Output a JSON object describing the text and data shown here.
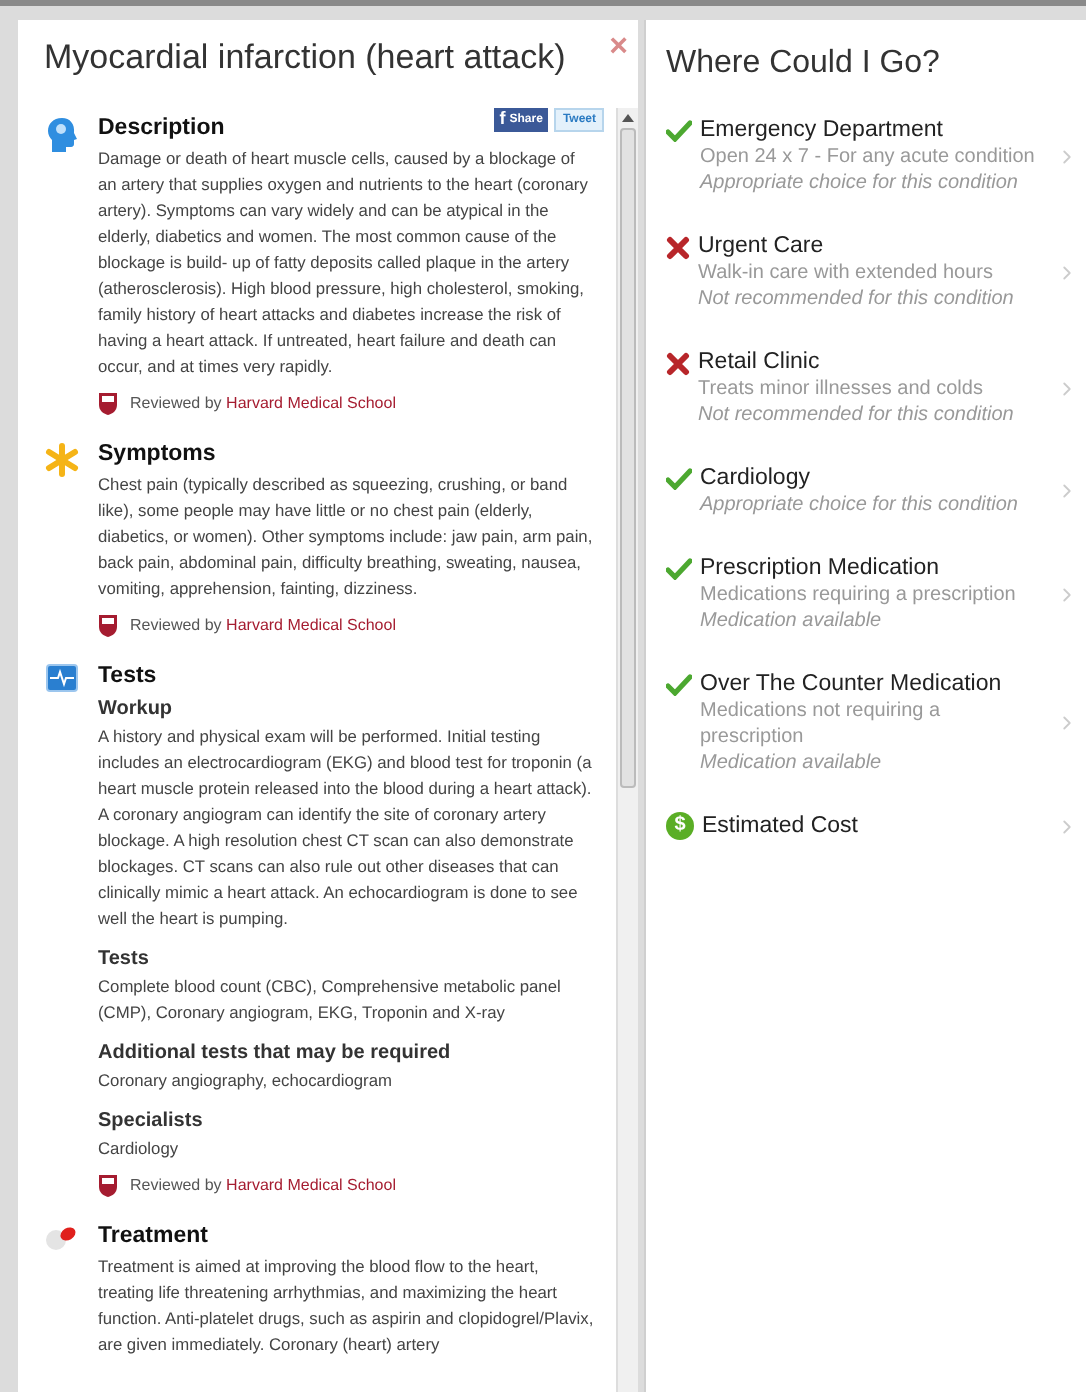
{
  "condition_panel": {
    "title": "Myocardial infarction (heart attack)",
    "close": "×",
    "share": {
      "icon": "f",
      "label": "Share"
    },
    "tweet": {
      "label": "Tweet"
    },
    "sections": [
      {
        "kind": "description",
        "title": "Description",
        "blocks": [
          {
            "text": "Damage or death of heart muscle cells, caused by a blockage of an artery that supplies oxygen and nutrients to the heart (coronary artery). Symptoms can vary widely and can be atypical in the elderly, diabetics and women. The most common cause of the blockage is build- up of fatty deposits called plaque in the artery (atherosclerosis). High blood pressure, high cholesterol, smoking, family history of heart attacks and diabetes increase the risk of having a heart attack. If untreated, heart failure and death can occur, and at times very rapidly."
          }
        ],
        "reviewed": {
          "prefix": "Reviewed by",
          "source": "Harvard Medical School"
        }
      },
      {
        "kind": "symptoms",
        "title": "Symptoms",
        "blocks": [
          {
            "text": "Chest pain (typically described as squeezing, crushing, or band like), some people may have little or no chest pain (elderly, diabetics, or women). Other symptoms include: jaw pain, arm pain, back pain, abdominal pain, difficulty breathing, sweating, nausea, vomiting, apprehension, fainting, dizziness."
          }
        ],
        "reviewed": {
          "prefix": "Reviewed by",
          "source": "Harvard Medical School"
        }
      },
      {
        "kind": "tests",
        "title": "Tests",
        "blocks": [
          {
            "heading": "Workup",
            "text": "A history and physical exam will be performed. Initial testing includes an electrocardiogram (EKG) and blood test for troponin (a heart muscle protein released into the blood during a heart attack). A coronary angiogram can identify the site of coronary artery blockage. A high resolution chest CT scan can also demonstrate blockages. CT scans can also rule out other diseases that can clinically mimic a heart attack. An echocardiogram is done to see well the heart is pumping."
          },
          {
            "heading": "Tests",
            "text": "Complete blood count (CBC), Comprehensive metabolic panel (CMP), Coronary angiogram, EKG, Troponin and X-ray"
          },
          {
            "heading": "Additional tests that may be required",
            "text": "Coronary angiography, echocardiogram"
          },
          {
            "heading": "Specialists",
            "text": "Cardiology"
          }
        ],
        "reviewed": {
          "prefix": "Reviewed by",
          "source": "Harvard Medical School"
        }
      },
      {
        "kind": "treatment",
        "title": "Treatment",
        "blocks": [
          {
            "text": "Treatment is aimed at improving the blood flow to the heart, treating life threatening arrhythmias, and maximizing the heart function. Anti-platelet drugs, such as aspirin and clopidogrel/Plavix, are given immediately. Coronary (heart) artery"
          }
        ]
      }
    ]
  },
  "care_panel": {
    "title": "Where Could I Go?",
    "options": [
      {
        "kind": "recommended",
        "name": "Emergency Department",
        "detail": "Open 24 x 7 - For any acute condition",
        "note": "Appropriate choice for this condition"
      },
      {
        "kind": "not_recommended",
        "name": "Urgent Care",
        "detail": "Walk-in care with extended hours",
        "note": "Not recommended for this condition"
      },
      {
        "kind": "not_recommended",
        "name": "Retail Clinic",
        "detail": "Treats minor illnesses and colds",
        "note": "Not recommended for this condition"
      },
      {
        "kind": "recommended",
        "name": "Cardiology",
        "note": "Appropriate choice for this condition"
      },
      {
        "kind": "recommended",
        "name": "Prescription Medication",
        "detail": "Medications requiring a prescription",
        "note": "Medication available"
      },
      {
        "kind": "recommended",
        "name": "Over The Counter Medication",
        "detail": "Medications not requiring a prescription",
        "note": "Medication available"
      },
      {
        "kind": "cost",
        "name": "Estimated Cost",
        "icon": "$"
      }
    ]
  }
}
